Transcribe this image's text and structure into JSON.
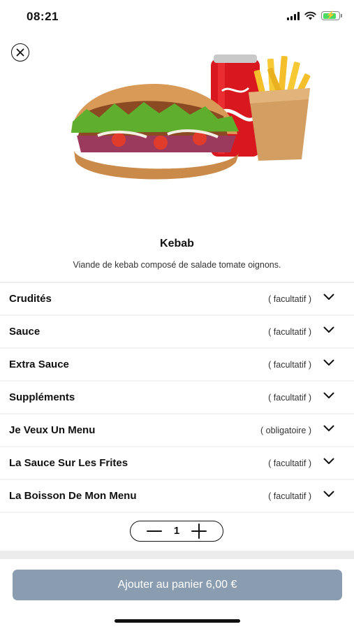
{
  "status_bar": {
    "time": "08:21"
  },
  "product": {
    "name": "Kebab",
    "description": "Viande de kebab composé de salade tomate oignons.",
    "image_icon": "kebab-fries-drink-photo"
  },
  "options": [
    {
      "label": "Crudités",
      "tag": "( facultatif )"
    },
    {
      "label": "Sauce",
      "tag": "( facultatif )"
    },
    {
      "label": "Extra Sauce",
      "tag": "( facultatif )"
    },
    {
      "label": "Suppléments",
      "tag": "( facultatif )"
    },
    {
      "label": "Je Veux Un Menu",
      "tag": "( obligatoire )"
    },
    {
      "label": "La Sauce Sur Les Frites",
      "tag": "( facultatif )"
    },
    {
      "label": "La Boisson De Mon Menu",
      "tag": "( facultatif )"
    }
  ],
  "quantity": {
    "value": "1"
  },
  "cart_button": {
    "label": "Ajouter au panier 6,00 €"
  },
  "colors": {
    "button_bg": "#8a9db0",
    "battery_green": "#4cd964"
  }
}
